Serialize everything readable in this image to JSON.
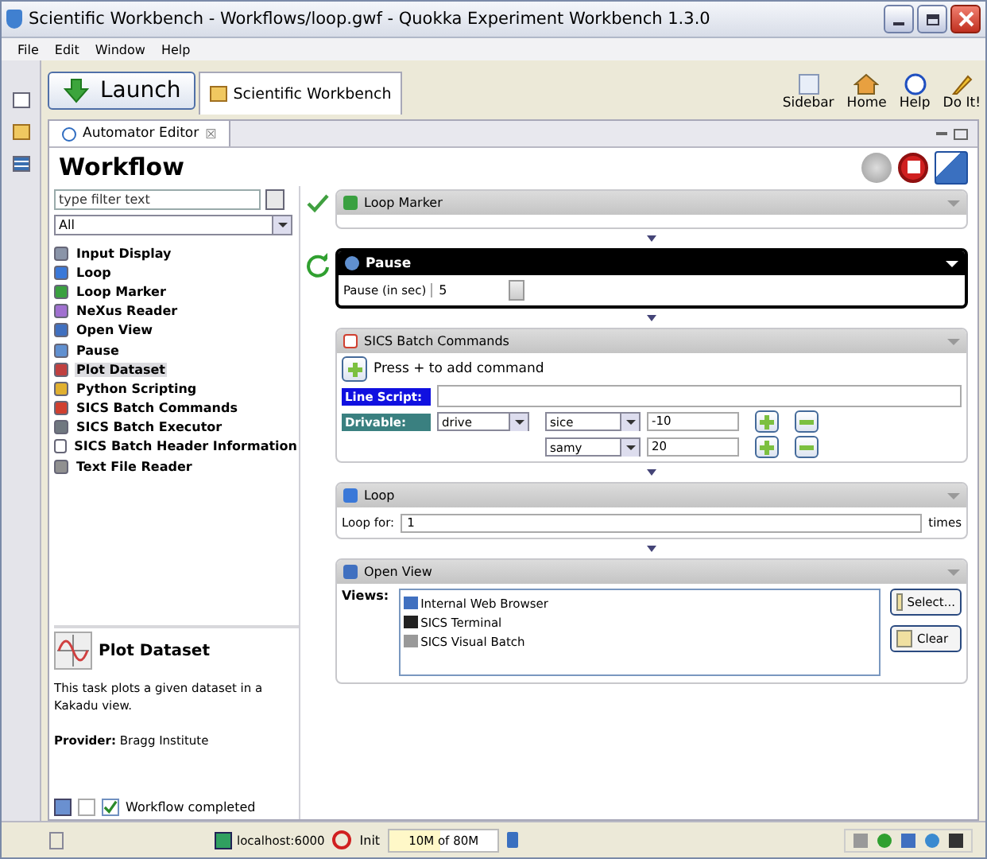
{
  "window": {
    "title": "Scientific Workbench - Workflows/loop.gwf - Quokka Experiment Workbench 1.3.0"
  },
  "menu": [
    "File",
    "Edit",
    "Window",
    "Help"
  ],
  "toolbar": {
    "launch": "Launch",
    "perspective": "Scientific Workbench",
    "actions": [
      {
        "label": "Sidebar",
        "kind": "sidebar"
      },
      {
        "label": "Home",
        "kind": "home"
      },
      {
        "label": "Help",
        "kind": "help"
      },
      {
        "label": "Do It!",
        "kind": "doit"
      }
    ]
  },
  "editor_tab": {
    "label": "Automator Editor",
    "close": "☒"
  },
  "heading": "Workflow",
  "filter": {
    "placeholder": "type filter text"
  },
  "category": "All",
  "tasks": [
    {
      "label": "Input Display",
      "selected": false
    },
    {
      "label": "Loop",
      "selected": false
    },
    {
      "label": "Loop Marker",
      "selected": false
    },
    {
      "label": "NeXus Reader",
      "selected": false
    },
    {
      "label": "Open View",
      "selected": false
    },
    {
      "label": "Pause",
      "selected": false
    },
    {
      "label": "Plot Dataset",
      "selected": true
    },
    {
      "label": "Python Scripting",
      "selected": false
    },
    {
      "label": "SICS Batch Commands",
      "selected": false
    },
    {
      "label": "SICS Batch Executor",
      "selected": false
    },
    {
      "label": "SICS Batch Header Information",
      "selected": false
    },
    {
      "label": "Text File Reader",
      "selected": false
    }
  ],
  "description": {
    "title": "Plot Dataset",
    "text": "This task plots a given dataset in a Kakadu view.",
    "provider_label": "Provider:",
    "provider": "Bragg Institute"
  },
  "workflow_status": {
    "label": "Workflow completed",
    "checked": true
  },
  "blocks": [
    {
      "kind": "marker",
      "title": "Loop Marker",
      "active": false,
      "done": true,
      "running": false
    },
    {
      "kind": "pause",
      "title": "Pause",
      "active": true,
      "done": false,
      "running": true,
      "label": "Pause (in sec)",
      "value": "5"
    },
    {
      "kind": "batch",
      "title": "SICS Batch Commands",
      "active": false,
      "hint": "Press + to add command",
      "script_label": "Line Script:",
      "drivable_label": "Drivable:",
      "drive": "drive",
      "rows": [
        {
          "motor": "sice",
          "value": "-10"
        },
        {
          "motor": "samy",
          "value": "20"
        }
      ]
    },
    {
      "kind": "loop",
      "title": "Loop",
      "active": false,
      "label": "Loop for:",
      "value": "1",
      "unit": "times"
    },
    {
      "kind": "view",
      "title": "Open View",
      "active": false,
      "label": "Views:",
      "views": [
        "Internal Web Browser",
        "SICS Terminal",
        "SICS Visual Batch"
      ],
      "buttons": [
        "Select...",
        "Clear"
      ]
    }
  ],
  "status_bar": {
    "host": "localhost:6000",
    "state": "Init",
    "memory": "10M of 80M",
    "level": 0.47
  }
}
